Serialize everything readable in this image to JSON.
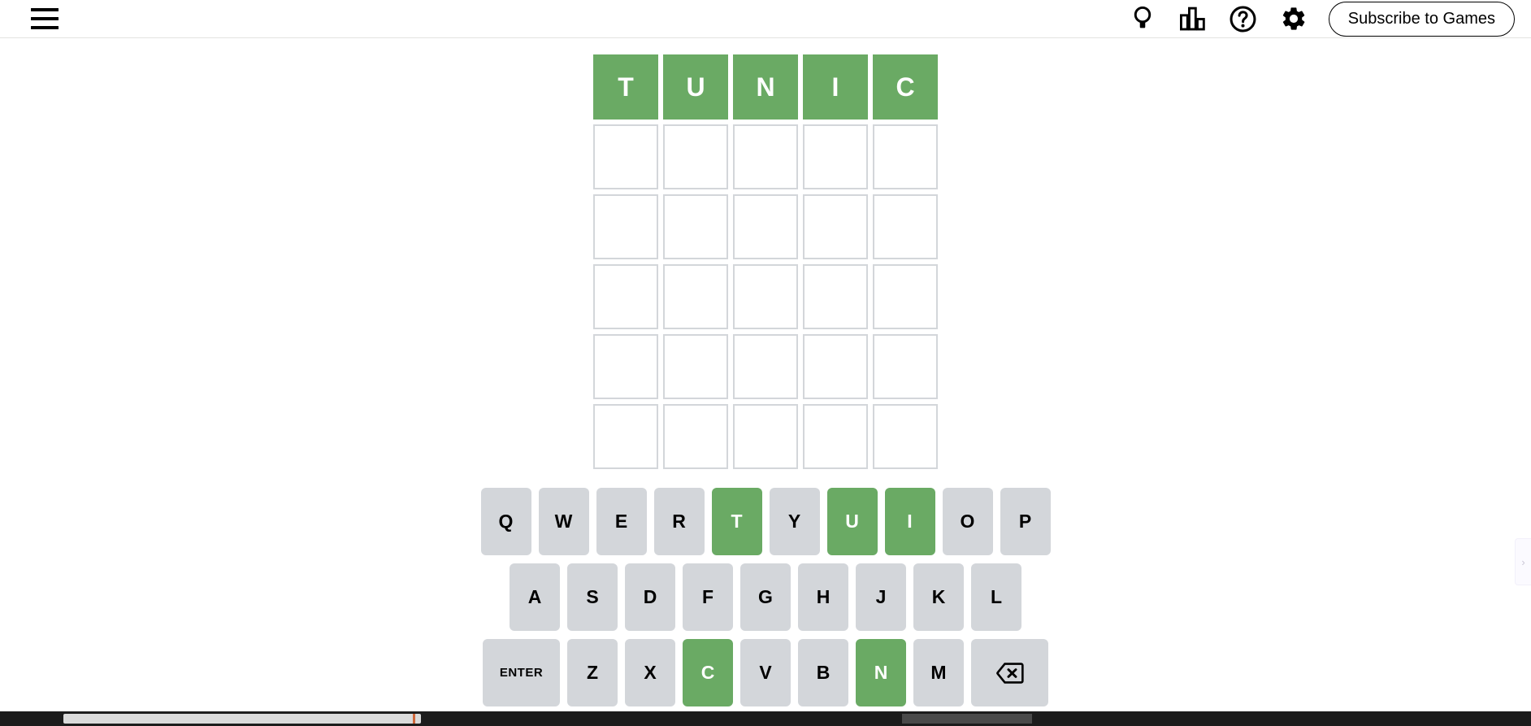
{
  "header": {
    "menu_icon": "hamburger-menu-icon",
    "icons": [
      {
        "name": "lightbulb-icon",
        "label": "Hint"
      },
      {
        "name": "bar-chart-icon",
        "label": "Statistics"
      },
      {
        "name": "question-mark-icon",
        "label": "Help"
      },
      {
        "name": "gear-icon",
        "label": "Settings"
      }
    ],
    "subscribe_label": "Subscribe to Games"
  },
  "board": {
    "rows": 6,
    "cols": 5,
    "tiles": [
      [
        {
          "letter": "T",
          "state": "correct"
        },
        {
          "letter": "U",
          "state": "correct"
        },
        {
          "letter": "N",
          "state": "correct"
        },
        {
          "letter": "I",
          "state": "correct"
        },
        {
          "letter": "C",
          "state": "correct"
        }
      ],
      [
        {
          "letter": "",
          "state": "empty"
        },
        {
          "letter": "",
          "state": "empty"
        },
        {
          "letter": "",
          "state": "empty"
        },
        {
          "letter": "",
          "state": "empty"
        },
        {
          "letter": "",
          "state": "empty"
        }
      ],
      [
        {
          "letter": "",
          "state": "empty"
        },
        {
          "letter": "",
          "state": "empty"
        },
        {
          "letter": "",
          "state": "empty"
        },
        {
          "letter": "",
          "state": "empty"
        },
        {
          "letter": "",
          "state": "empty"
        }
      ],
      [
        {
          "letter": "",
          "state": "empty"
        },
        {
          "letter": "",
          "state": "empty"
        },
        {
          "letter": "",
          "state": "empty"
        },
        {
          "letter": "",
          "state": "empty"
        },
        {
          "letter": "",
          "state": "empty"
        }
      ],
      [
        {
          "letter": "",
          "state": "empty"
        },
        {
          "letter": "",
          "state": "empty"
        },
        {
          "letter": "",
          "state": "empty"
        },
        {
          "letter": "",
          "state": "empty"
        },
        {
          "letter": "",
          "state": "empty"
        }
      ],
      [
        {
          "letter": "",
          "state": "empty"
        },
        {
          "letter": "",
          "state": "empty"
        },
        {
          "letter": "",
          "state": "empty"
        },
        {
          "letter": "",
          "state": "empty"
        },
        {
          "letter": "",
          "state": "empty"
        }
      ]
    ],
    "solved_word": "TUNIC"
  },
  "keyboard": {
    "rows": [
      [
        {
          "label": "Q",
          "state": "unused"
        },
        {
          "label": "W",
          "state": "unused"
        },
        {
          "label": "E",
          "state": "unused"
        },
        {
          "label": "R",
          "state": "unused"
        },
        {
          "label": "T",
          "state": "correct"
        },
        {
          "label": "Y",
          "state": "unused"
        },
        {
          "label": "U",
          "state": "correct"
        },
        {
          "label": "I",
          "state": "correct"
        },
        {
          "label": "O",
          "state": "unused"
        },
        {
          "label": "P",
          "state": "unused"
        }
      ],
      [
        {
          "label": "A",
          "state": "unused"
        },
        {
          "label": "S",
          "state": "unused"
        },
        {
          "label": "D",
          "state": "unused"
        },
        {
          "label": "F",
          "state": "unused"
        },
        {
          "label": "G",
          "state": "unused"
        },
        {
          "label": "H",
          "state": "unused"
        },
        {
          "label": "J",
          "state": "unused"
        },
        {
          "label": "K",
          "state": "unused"
        },
        {
          "label": "L",
          "state": "unused"
        }
      ],
      [
        {
          "label": "ENTER",
          "state": "unused",
          "wide": true
        },
        {
          "label": "Z",
          "state": "unused"
        },
        {
          "label": "X",
          "state": "unused"
        },
        {
          "label": "C",
          "state": "correct"
        },
        {
          "label": "V",
          "state": "unused"
        },
        {
          "label": "B",
          "state": "unused"
        },
        {
          "label": "N",
          "state": "correct"
        },
        {
          "label": "M",
          "state": "unused"
        },
        {
          "label": "",
          "state": "unused",
          "wide": true,
          "icon": "backspace-icon"
        }
      ]
    ]
  },
  "edge_tab": {
    "icon": "chevron-right-icon",
    "label": "›"
  },
  "colors": {
    "correct": "#6aaa64",
    "present": "#c9b458",
    "absent": "#787c7e",
    "key_default": "#d3d6da",
    "tile_border": "#d3d6da",
    "background": "#ffffff",
    "text": "#000000"
  }
}
